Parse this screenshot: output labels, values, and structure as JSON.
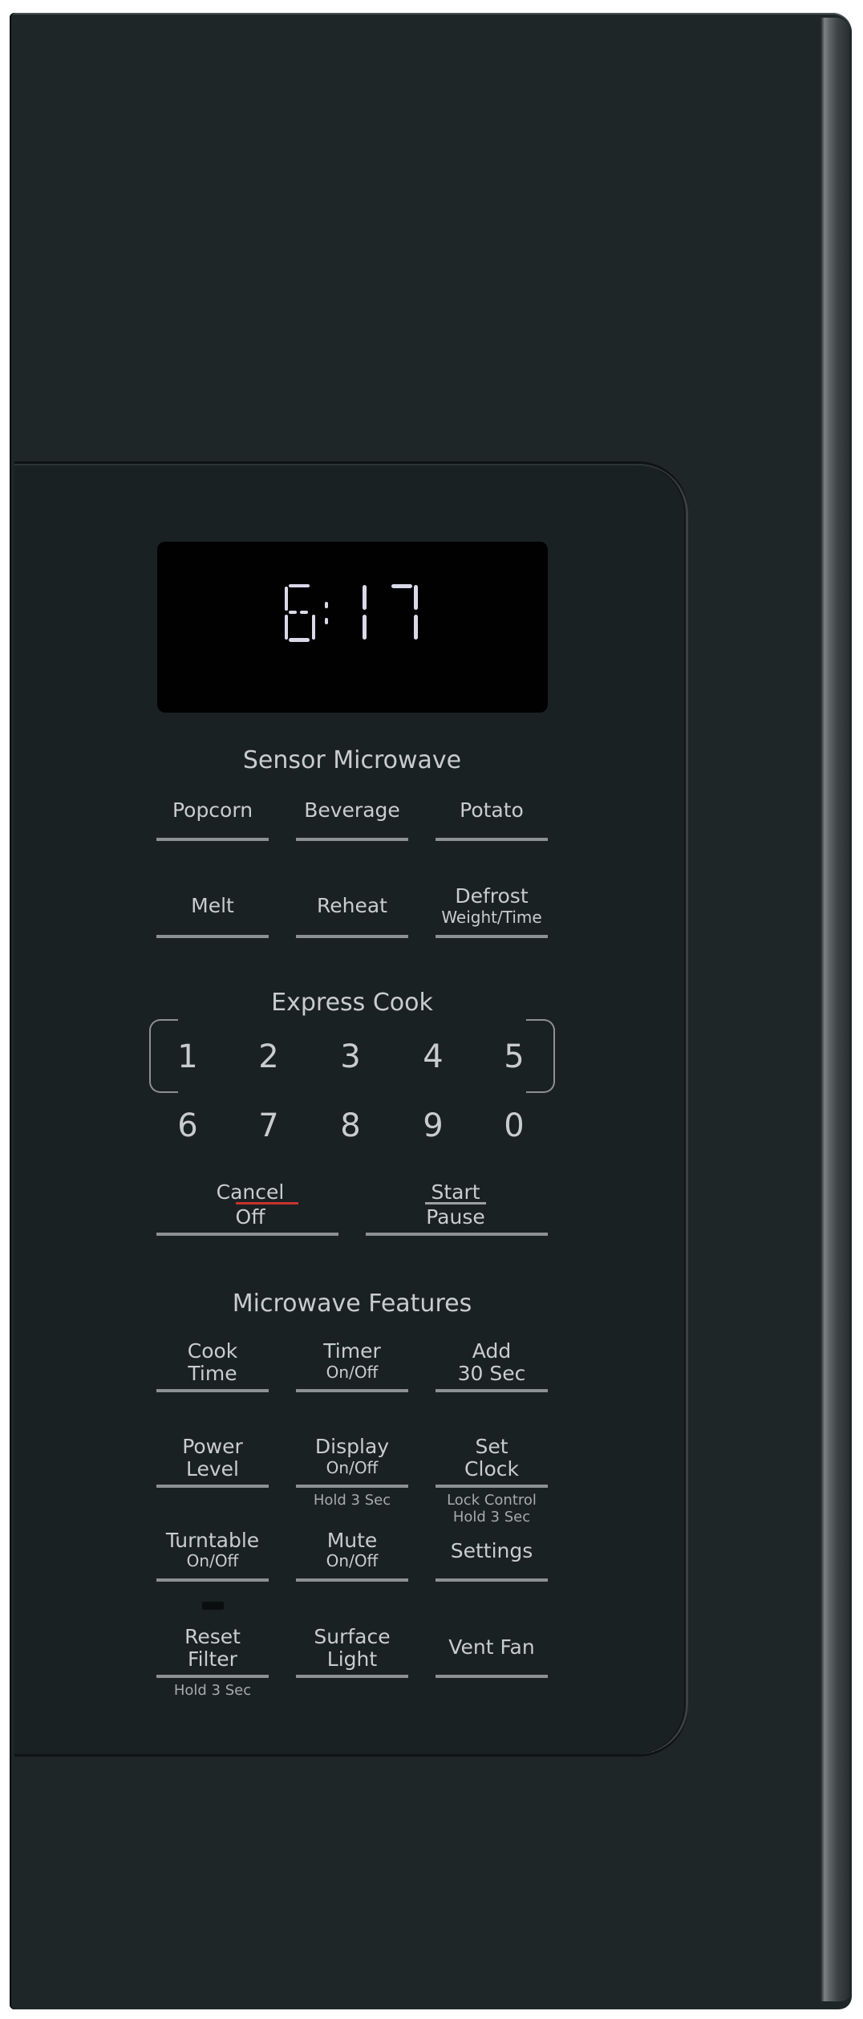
{
  "display": {
    "time": "6:17",
    "digit_color": "#d9d9ea"
  },
  "sensor": {
    "heading": "Sensor Microwave",
    "keys": [
      {
        "label": "Popcorn"
      },
      {
        "label": "Beverage"
      },
      {
        "label": "Potato"
      },
      {
        "label": "Melt"
      },
      {
        "label": "Reheat"
      },
      {
        "label": "Defrost",
        "sub": "Weight/Time"
      }
    ]
  },
  "express": {
    "heading": "Express Cook",
    "digits": [
      "1",
      "2",
      "3",
      "4",
      "5",
      "6",
      "7",
      "8",
      "9",
      "0"
    ]
  },
  "controls": {
    "cancel": {
      "label": "Cancel",
      "sub": "Off",
      "accent": "#c8342b"
    },
    "start": {
      "label": "Start",
      "sub": "Pause"
    }
  },
  "features": {
    "heading": "Microwave Features",
    "keys": [
      {
        "line1": "Cook",
        "line2": "Time"
      },
      {
        "line1": "Timer",
        "line2": "On/Off"
      },
      {
        "line1": "Add",
        "line2": "30 Sec"
      },
      {
        "line1": "Power",
        "line2": "Level"
      },
      {
        "line1": "Display",
        "line2": "On/Off",
        "note": "Hold 3 Sec"
      },
      {
        "line1": "Set",
        "line2": "Clock",
        "note1": "Lock Control",
        "note2": "Hold 3 Sec"
      },
      {
        "line1": "Turntable",
        "line2": "On/Off"
      },
      {
        "line1": "Mute",
        "line2": "On/Off"
      },
      {
        "line1": "Settings"
      },
      {
        "line1": "Reset",
        "line2": "Filter",
        "note": "Hold 3 Sec"
      },
      {
        "line1": "Surface",
        "line2": "Light"
      },
      {
        "line1": "Vent Fan"
      }
    ]
  }
}
